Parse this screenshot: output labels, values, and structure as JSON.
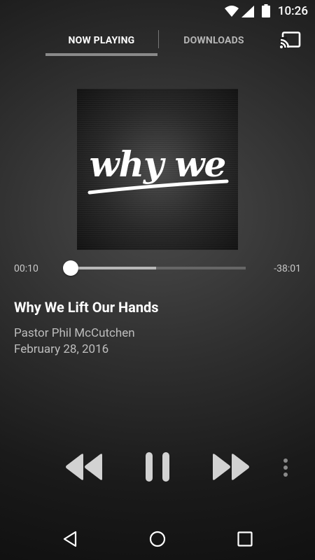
{
  "status_bar": {
    "time": "10:26",
    "icons": [
      "wifi-icon",
      "cell-signal-icon",
      "battery-icon"
    ]
  },
  "tabs": [
    {
      "label": "NOW PLAYING",
      "active": true
    },
    {
      "label": "DOWNLOADS",
      "active": false
    }
  ],
  "cast_icon": "cast-icon",
  "artwork": {
    "text": "why we"
  },
  "player": {
    "elapsed": "00:10",
    "remaining": "-38:01",
    "progress_fraction": 0.004,
    "buffered_fraction": 0.49
  },
  "track": {
    "title": "Why We Lift Our Hands",
    "speaker": "Pastor Phil McCutchen",
    "date": "February 28, 2016"
  },
  "controls": [
    "rewind-icon",
    "pause-icon",
    "fast-forward-icon",
    "more-vert-icon"
  ],
  "nav_bar": [
    "back-icon",
    "home-icon",
    "recents-icon"
  ],
  "colors": {
    "accent": "#ffffff",
    "secondary_text": "#bdbdbd",
    "track_bg": "#666666",
    "track_buffer": "#b8b8b8"
  }
}
